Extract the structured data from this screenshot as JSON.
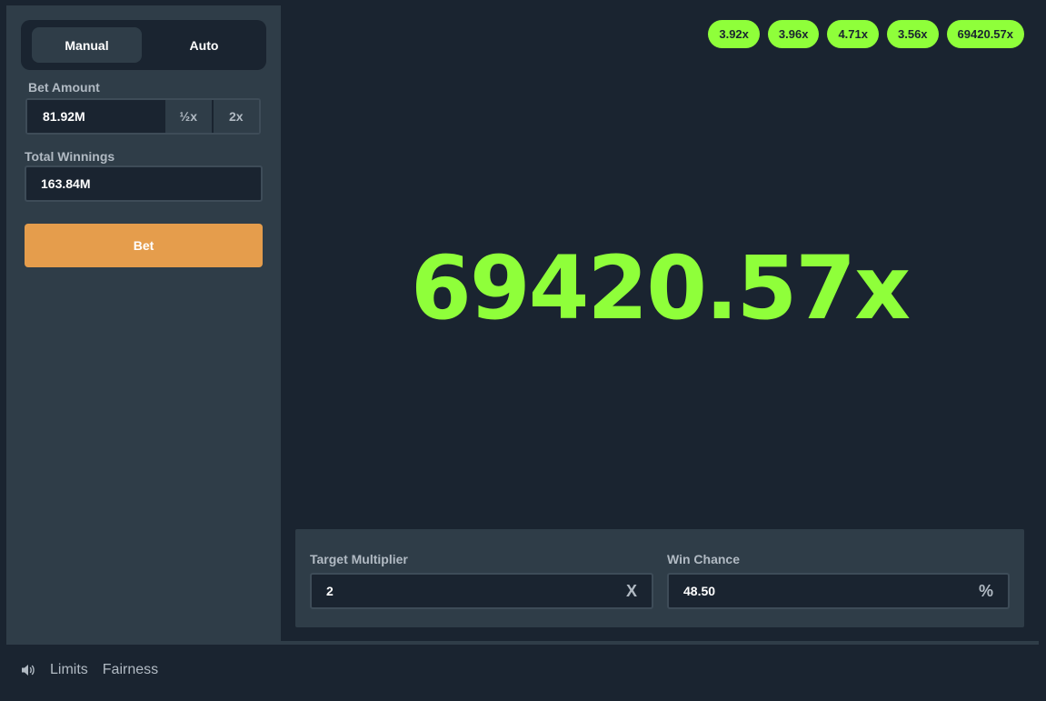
{
  "sidebar": {
    "tabs": {
      "manual": "Manual",
      "auto": "Auto"
    },
    "bet_amount": {
      "label": "Bet Amount",
      "value": "81.92M",
      "half": "½x",
      "double": "2x"
    },
    "total_winnings": {
      "label": "Total Winnings",
      "value": "163.84M"
    },
    "bet_button": "Bet"
  },
  "history": [
    "3.92x",
    "3.96x",
    "4.71x",
    "3.56x",
    "69420.57x"
  ],
  "result": "69420.57x",
  "controls": {
    "target_multiplier": {
      "label": "Target Multiplier",
      "value": "2",
      "suffix": "X"
    },
    "win_chance": {
      "label": "Win Chance",
      "value": "48.50",
      "suffix": "%"
    }
  },
  "footer": {
    "sound_icon": "speaker-icon",
    "limits": "Limits",
    "fairness": "Fairness"
  },
  "colors": {
    "accent_green": "#8fff3a",
    "bet_orange": "#e59d4c",
    "bg_dark": "#1a2430",
    "panel": "#2f3d48"
  }
}
